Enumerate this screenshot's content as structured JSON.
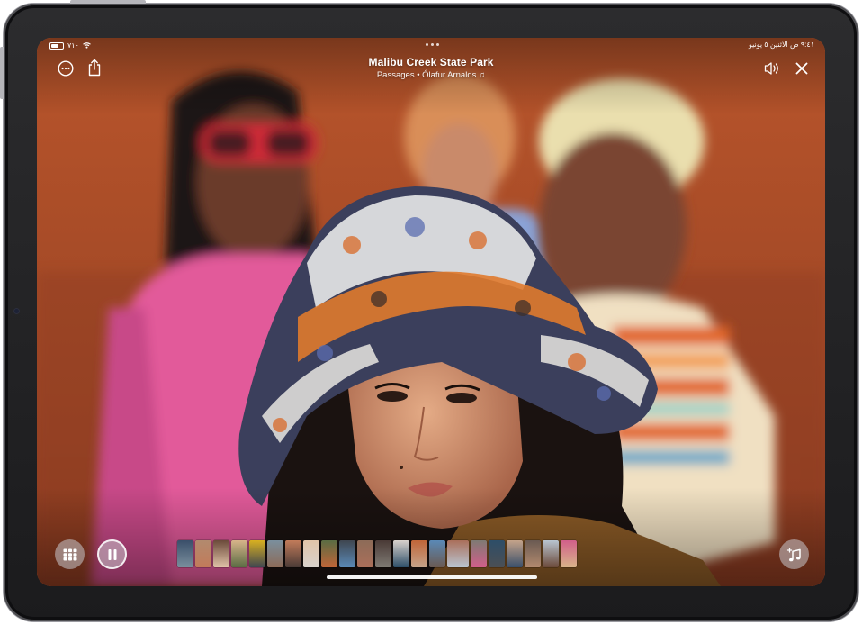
{
  "status_bar": {
    "left_text": "٧١٠",
    "right_text": "٩:٤١ ص  الاثنين ٥ يونيو"
  },
  "memory": {
    "title": "Malibu Creek State Park",
    "subtitle": "Passages • Ólafur Arnalds ♫"
  },
  "icons": {
    "more": "more-ellipsis-icon",
    "share": "share-icon",
    "mute": "speaker-mute-icon",
    "close": "close-icon",
    "grid": "grid-icon",
    "pause": "pause-icon",
    "music": "music-note-plus-icon"
  },
  "filmstrip": {
    "count": 22,
    "colors": [
      "#3a4f6a",
      "#b28a6e",
      "#6b4a3a",
      "#d8b48a",
      "#d9b020",
      "#7a8f9d",
      "#c27b5a",
      "#e0c3a8",
      "#5a6c43",
      "#3f4650",
      "#8c6b58",
      "#4a3a36",
      "#d9d2cc",
      "#c06538",
      "#5a89b6",
      "#aa6f5a",
      "#7e7a73",
      "#2d4e68",
      "#c5a38a",
      "#6a5a52",
      "#b9c5d1",
      "#d25f8a",
      "#4b4f54"
    ]
  },
  "colors": {
    "accent": "#ffffff",
    "background_orange": "#a8502a"
  }
}
